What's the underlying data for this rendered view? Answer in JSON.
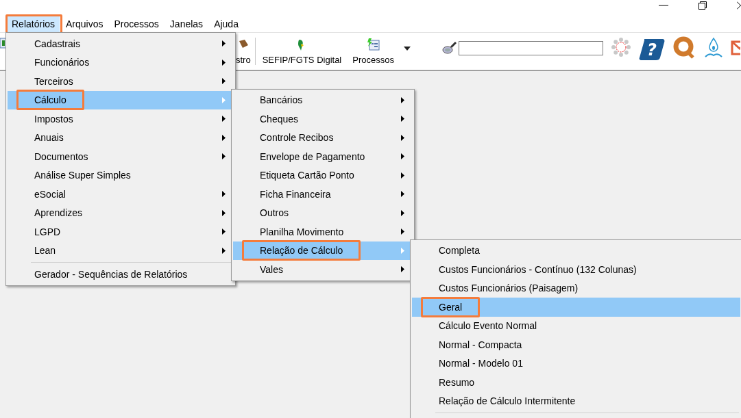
{
  "menu_bar": [
    {
      "label": "Relatórios",
      "selected": true
    },
    {
      "label": "Arquivos",
      "selected": false
    },
    {
      "label": "Processos",
      "selected": false
    },
    {
      "label": "Janelas",
      "selected": false
    },
    {
      "label": "Ajuda",
      "selected": false
    }
  ],
  "toolbar": {
    "buttons": [
      {
        "label": "stro"
      },
      {
        "label": "SEFIP/FGTS Digital"
      },
      {
        "label": "Processos"
      }
    ],
    "help_icon_glyph": "?"
  },
  "menu": {
    "items": [
      {
        "kind": "item",
        "label": "Cadastrais",
        "has_submenu": true,
        "selected": false
      },
      {
        "kind": "item",
        "label": "Funcionários",
        "has_submenu": true,
        "selected": false
      },
      {
        "kind": "item",
        "label": "Terceiros",
        "has_submenu": true,
        "selected": false
      },
      {
        "kind": "item",
        "label": "Cálculo",
        "has_submenu": true,
        "selected": true,
        "submenu": {
          "items": [
            {
              "kind": "item",
              "label": "Bancários",
              "has_submenu": true,
              "selected": false
            },
            {
              "kind": "item",
              "label": "Cheques",
              "has_submenu": true,
              "selected": false
            },
            {
              "kind": "item",
              "label": "Controle Recibos",
              "has_submenu": true,
              "selected": false
            },
            {
              "kind": "item",
              "label": "Envelope de Pagamento",
              "has_submenu": true,
              "selected": false
            },
            {
              "kind": "item",
              "label": "Etiqueta Cartão Ponto",
              "has_submenu": true,
              "selected": false
            },
            {
              "kind": "item",
              "label": "Ficha Financeira",
              "has_submenu": true,
              "selected": false
            },
            {
              "kind": "item",
              "label": "Outros",
              "has_submenu": true,
              "selected": false
            },
            {
              "kind": "item",
              "label": "Planilha Movimento",
              "has_submenu": true,
              "selected": false
            },
            {
              "kind": "item",
              "label": "Relação de Cálculo",
              "has_submenu": true,
              "selected": true,
              "submenu": {
                "items": [
                  {
                    "kind": "item",
                    "label": "Completa",
                    "has_submenu": false,
                    "selected": false
                  },
                  {
                    "kind": "item",
                    "label": "Custos Funcionários - Contínuo (132 Colunas)",
                    "has_submenu": false,
                    "selected": false
                  },
                  {
                    "kind": "item",
                    "label": "Custos Funcionários (Paisagem)",
                    "has_submenu": false,
                    "selected": false
                  },
                  {
                    "kind": "item",
                    "label": "Geral",
                    "has_submenu": false,
                    "selected": true
                  },
                  {
                    "kind": "item",
                    "label": "Cálculo Evento Normal",
                    "has_submenu": false,
                    "selected": false
                  },
                  {
                    "kind": "item",
                    "label": "Normal - Compacta",
                    "has_submenu": false,
                    "selected": false
                  },
                  {
                    "kind": "item",
                    "label": "Normal - Modelo 01",
                    "has_submenu": false,
                    "selected": false
                  },
                  {
                    "kind": "item",
                    "label": "Resumo",
                    "has_submenu": false,
                    "selected": false
                  },
                  {
                    "kind": "item",
                    "label": "Relação de Cálculo Intermitente",
                    "has_submenu": false,
                    "selected": false
                  },
                  {
                    "kind": "separator"
                  }
                ]
              }
            },
            {
              "kind": "item",
              "label": "Vales",
              "has_submenu": true,
              "selected": false
            }
          ]
        }
      },
      {
        "kind": "item",
        "label": "Impostos",
        "has_submenu": true,
        "selected": false
      },
      {
        "kind": "item",
        "label": "Anuais",
        "has_submenu": true,
        "selected": false
      },
      {
        "kind": "item",
        "label": "Documentos",
        "has_submenu": true,
        "selected": false
      },
      {
        "kind": "item",
        "label": "Análise Super Simples",
        "has_submenu": false,
        "selected": false
      },
      {
        "kind": "item",
        "label": "eSocial",
        "has_submenu": true,
        "selected": false
      },
      {
        "kind": "item",
        "label": "Aprendizes",
        "has_submenu": true,
        "selected": false
      },
      {
        "kind": "item",
        "label": "LGPD",
        "has_submenu": true,
        "selected": false
      },
      {
        "kind": "item",
        "label": "Lean",
        "has_submenu": true,
        "selected": false
      },
      {
        "kind": "separator"
      },
      {
        "kind": "item",
        "label": "Gerador - Sequências de Relatórios",
        "has_submenu": false,
        "selected": false
      }
    ]
  }
}
